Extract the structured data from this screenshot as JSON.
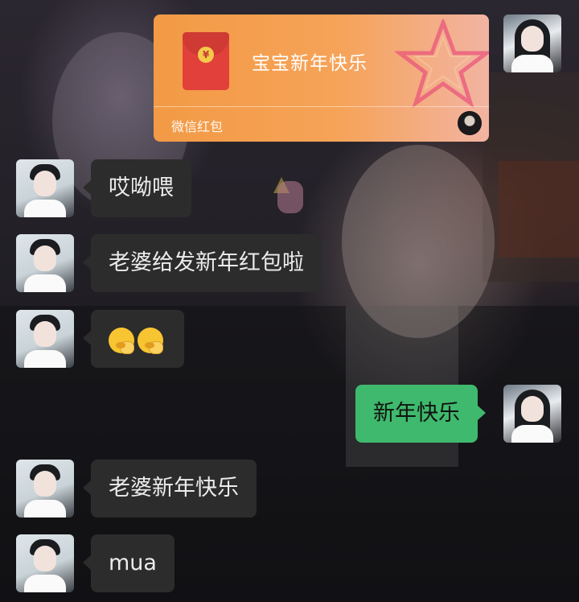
{
  "red_packet": {
    "title": "宝宝新年快乐",
    "label": "微信红包",
    "coin_symbol": "¥",
    "color": "#f29a45"
  },
  "messages": [
    {
      "side": "left",
      "text": "哎呦喂"
    },
    {
      "side": "left",
      "text": "老婆给发新年红包啦"
    },
    {
      "side": "left",
      "emoji": [
        "face-with-hand-over-mouth-icon",
        "face-with-hand-over-mouth-icon"
      ]
    },
    {
      "side": "right",
      "text": "新年快乐"
    },
    {
      "side": "left",
      "text": "老婆新年快乐"
    },
    {
      "side": "left",
      "text": "mua"
    }
  ],
  "colors": {
    "incoming_bubble": "#2c2c2c",
    "outgoing_bubble": "#3fb96d"
  }
}
